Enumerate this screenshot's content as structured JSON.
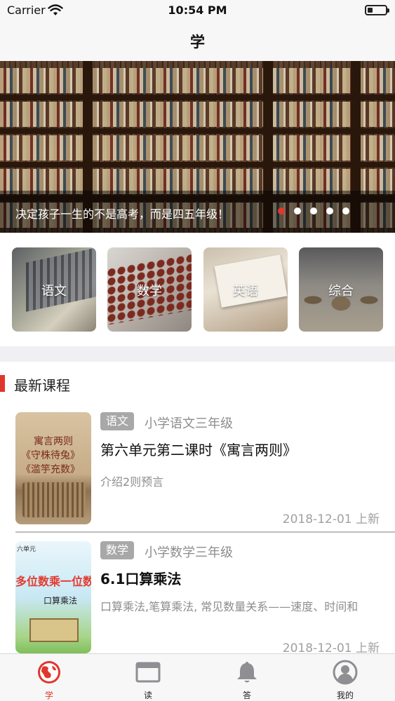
{
  "status_bar": {
    "carrier": "Carrier",
    "time": "10:54 PM",
    "battery_level": 0.3
  },
  "nav": {
    "title": "学"
  },
  "banner": {
    "caption": "决定孩子一生的不是高考，而是四五年级！",
    "page_count": 5,
    "active_page": 0
  },
  "categories": [
    {
      "label": "语文"
    },
    {
      "label": "数学"
    },
    {
      "label": "英语"
    },
    {
      "label": "综合"
    }
  ],
  "section": {
    "title": "最新课程"
  },
  "courses": [
    {
      "tag": "语文",
      "grade": "小学语文三年级",
      "title": "第六单元第二课时《寓言两则》",
      "description": "介绍2则预言",
      "date": "2018-12-01 上新",
      "thumb_text_1": "寓言两则",
      "thumb_text_2": "《守株待兔》",
      "thumb_text_3": "《滥竽充数》"
    },
    {
      "tag": "数学",
      "grade": "小学数学三年级",
      "title": "6.1口算乘法",
      "description": "口算乘法,笔算乘法, 常见数量关系——速度、时间和",
      "date": "2018-12-01 上新",
      "thumb_top": "六单元",
      "thumb_red": "多位数乘一位数",
      "thumb_sub": "口算乘法"
    }
  ],
  "tab_bar": {
    "items": [
      {
        "label": "学",
        "icon": "globe-icon",
        "active": true
      },
      {
        "label": "读",
        "icon": "window-icon",
        "active": false
      },
      {
        "label": "答",
        "icon": "bell-icon",
        "active": false
      },
      {
        "label": "我的",
        "icon": "person-icon",
        "active": false
      }
    ]
  },
  "colors": {
    "accent": "#e0372d",
    "tab_inactive": "#8e8e93",
    "tag_bg": "#a8a8a8"
  }
}
